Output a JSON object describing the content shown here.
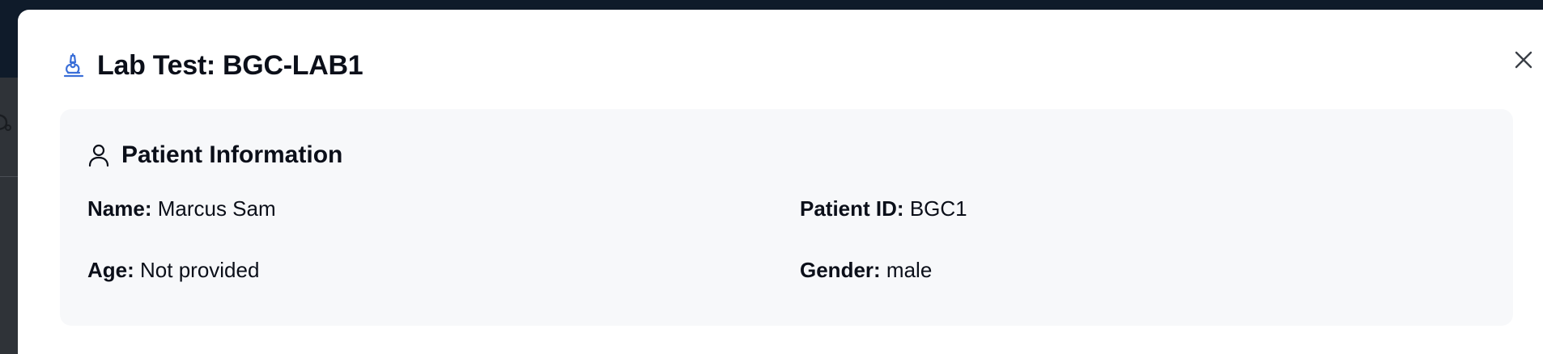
{
  "modal": {
    "title": "Lab Test: BGC-LAB1",
    "title_icon": "microscope-icon",
    "close_icon": "close-icon"
  },
  "patient_info": {
    "heading": "Patient Information",
    "heading_icon": "user-icon",
    "name_label": "Name:",
    "name_value": "Marcus Sam",
    "patient_id_label": "Patient ID:",
    "patient_id_value": "BGC1",
    "age_label": "Age:",
    "age_value": "Not provided",
    "gender_label": "Gender:",
    "gender_value": "male"
  },
  "colors": {
    "accent": "#3b6fd8",
    "card_background": "#f7f8fa",
    "text": "#0b0f19",
    "backdrop_topbar": "#0f1b2a",
    "backdrop_page": "#2f3338"
  }
}
